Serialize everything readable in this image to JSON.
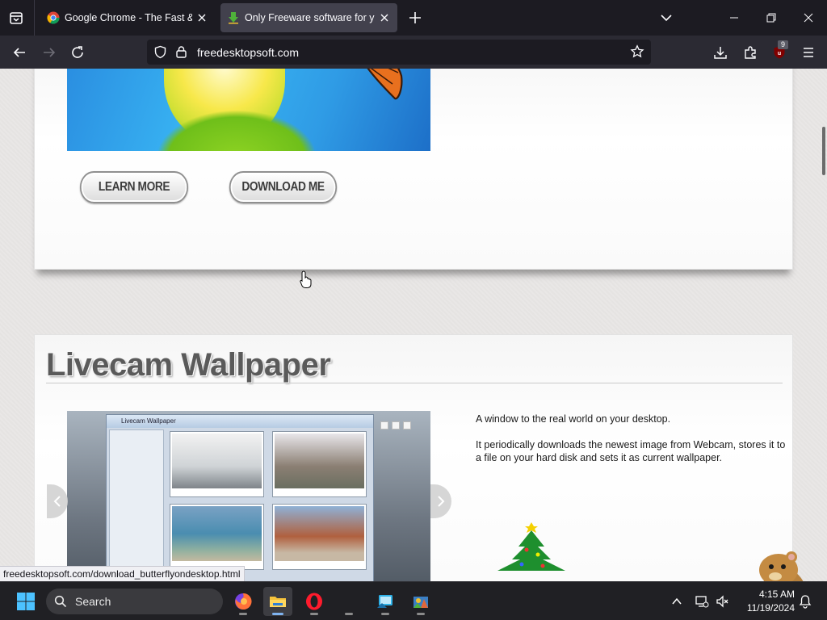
{
  "browser": {
    "tabs": [
      {
        "title": "Google Chrome - The Fast & Secure Web Browser",
        "favicon": "chrome-icon",
        "active": false
      },
      {
        "title": "Only Freeware software for your desktop",
        "favicon": "download-arrow-icon",
        "active": true
      }
    ],
    "url": "freedesktopsoft.com",
    "extension_badge": "9"
  },
  "page": {
    "panel1": {
      "learn_more_label": "LEARN MORE",
      "download_label": "DOWNLOAD ME"
    },
    "panel2": {
      "title": "Livecam Wallpaper",
      "description": [
        "A window to the real world on your desktop.",
        "It periodically downloads the newest image from Webcam, stores it to a file on your hard disk and sets it as current wallpaper."
      ],
      "screenshot_window_title": "Livecam Wallpaper"
    }
  },
  "status_link": "freedesktopsoft.com/download_butterflyondesktop.html",
  "taskbar": {
    "search_placeholder": "Search",
    "apps": [
      "firefox-icon",
      "file-explorer-icon",
      "opera-icon",
      "blank-app",
      "app-5-icon",
      "app-6-icon"
    ],
    "time": "4:15 AM",
    "date": "11/19/2024"
  },
  "colors": {
    "tab_strip": "#1c1b22",
    "toolbar": "#2b2a33",
    "page_background": "#e9e7e6",
    "taskbar": "#202024"
  }
}
